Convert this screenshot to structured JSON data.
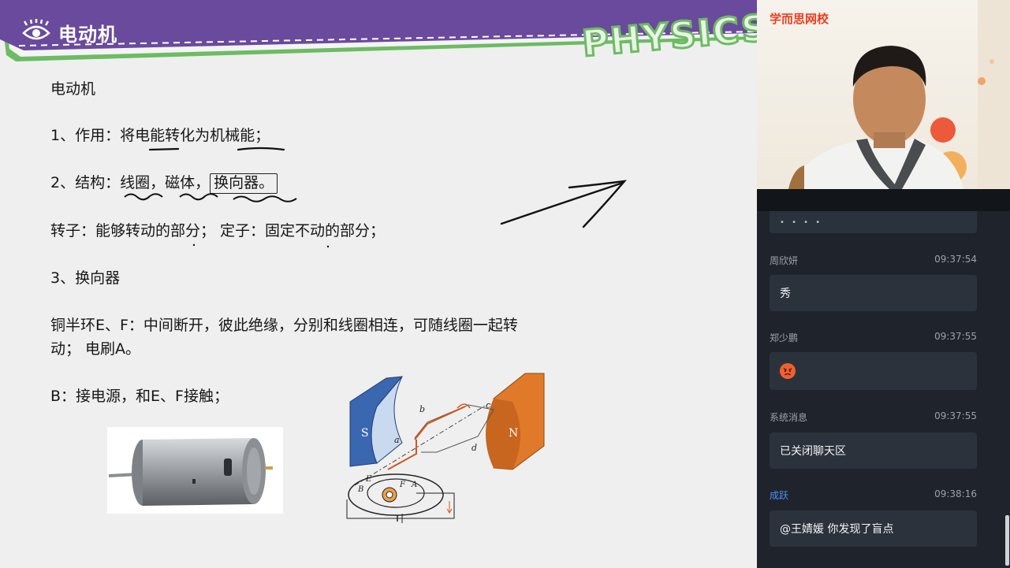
{
  "slide": {
    "header_title": "电动机",
    "header_deco": "PHYSICS",
    "lines": [
      "电动机",
      "1、作用：将电能转化为机械能；",
      "2、结构：线圈，磁体，",
      "换向器。",
      "转子：能够转动的部分；  定子：固定不动的部分；",
      "3、换向器",
      "铜半环E、F：中间断开，彼此绝缘，分别和线圈相连，可随线圈一起转",
      "动；  电刷A。",
      "B：接电源，和E、F接触；"
    ],
    "diagram_labels": {
      "S": "S",
      "N": "N",
      "a": "a",
      "b": "b",
      "c": "c",
      "d": "d",
      "E": "E",
      "F": "F",
      "A": "A",
      "B": "B"
    }
  },
  "video": {
    "brand": "学而思网校"
  },
  "chat": {
    "top_dots": "• • • •",
    "messages": [
      {
        "name": "周欣妍",
        "time": "09:37:54",
        "text": "秀"
      },
      {
        "name": "郑少鹏",
        "time": "09:37:55",
        "emoji": "angry-face"
      },
      {
        "name": "系统消息",
        "time": "09:37:55",
        "text": "已关闭聊天区"
      },
      {
        "name": "成跃",
        "time": "09:38:16",
        "text": "@王婧媛 你发现了盲点"
      }
    ]
  },
  "colors": {
    "header_purple": "#6a4a9c",
    "header_green": "#6dbb63",
    "brand_red": "#f03c1e",
    "chat_bg": "#1f242c",
    "bubble_bg": "#2c323c",
    "name_blue": "#4f8ff7"
  }
}
